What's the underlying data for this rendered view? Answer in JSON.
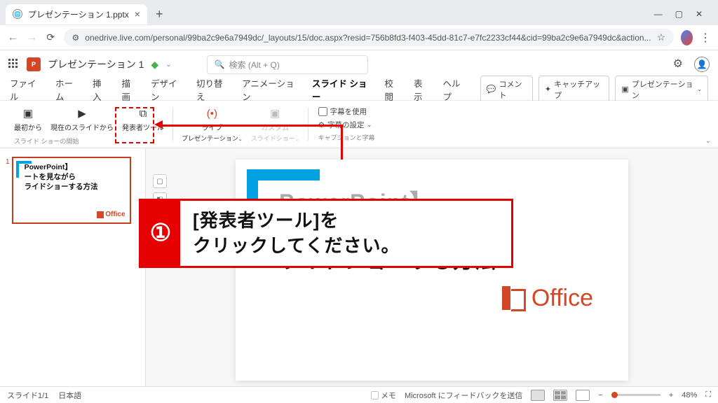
{
  "browser": {
    "tab_title": "プレゼンテーション 1.pptx",
    "url": "onedrive.live.com/personal/99ba2c9e6a7949dc/_layouts/15/doc.aspx?resid=756b8fd3-f403-45dd-81c7-e7fc2233cf44&cid=99ba2c9e6a7949dc&action..."
  },
  "app": {
    "doc_title": "プレゼンテーション 1",
    "search_placeholder": "検索 (Alt + Q)"
  },
  "ribbon_tabs": {
    "file": "ファイル",
    "home": "ホーム",
    "insert": "挿入",
    "draw": "描画",
    "design": "デザイン",
    "transitions": "切り替え",
    "animations": "アニメーション",
    "slideshow": "スライド ショー",
    "review": "校閲",
    "view": "表示",
    "help": "ヘルプ"
  },
  "ribbon_right": {
    "comment": "コメント",
    "catchup": "キャッチアップ",
    "present": "プレゼンテーション"
  },
  "ribbon": {
    "from_beginning": "最初から",
    "from_current": "現在のスライドから",
    "presenter": "発表者ツール",
    "live": "ライブ",
    "live_sub": "プレゼンテーション",
    "custom": "カスタム",
    "custom_sub": "スライドショー",
    "group1": "スライド ショーの開始",
    "use_captions": "字幕を使用",
    "caption_settings": "字幕の設定",
    "captions_group": "キャプションと字幕"
  },
  "thumbnail": {
    "index": "1",
    "line1": "PowerPoint】",
    "line2": "ートを見ながら",
    "line3": "ライドショーする方法",
    "office": "Office"
  },
  "slide": {
    "line1": "PowerPoint】",
    "line2": "ートを見ながら",
    "line3": "ライドショーする方法",
    "office": "Office"
  },
  "callout": {
    "num": "①",
    "text": "[発表者ツール]を\nクリックしてください。"
  },
  "status": {
    "slide": "スライド1/1",
    "lang": "日本語",
    "notes": "メモ",
    "feedback": "Microsoft にフィードバックを送信",
    "zoom": "48%"
  }
}
